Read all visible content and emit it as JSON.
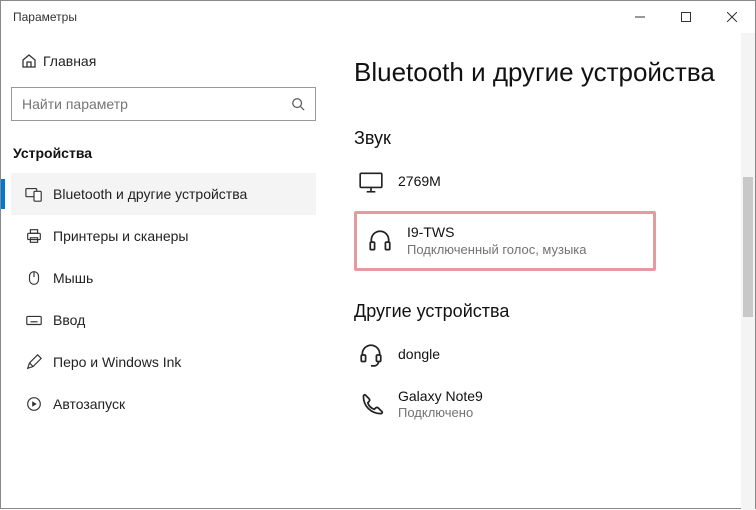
{
  "window": {
    "title": "Параметры"
  },
  "sidebar": {
    "home": "Главная",
    "search_placeholder": "Найти параметр",
    "section": "Устройства",
    "items": [
      {
        "label": "Bluetooth и другие устройства"
      },
      {
        "label": "Принтеры и сканеры"
      },
      {
        "label": "Мышь"
      },
      {
        "label": "Ввод"
      },
      {
        "label": "Перо и Windows Ink"
      },
      {
        "label": "Автозапуск"
      }
    ]
  },
  "main": {
    "title": "Bluetooth и другие устройства",
    "audio_group": "Звук",
    "other_group": "Другие устройства",
    "devices": {
      "monitor": {
        "name": "2769M"
      },
      "headphones": {
        "name": "I9-TWS",
        "status": "Подключенный голос, музыка"
      },
      "dongle": {
        "name": "dongle"
      },
      "phone": {
        "name": "Galaxy Note9",
        "status": "Подключено"
      }
    }
  }
}
